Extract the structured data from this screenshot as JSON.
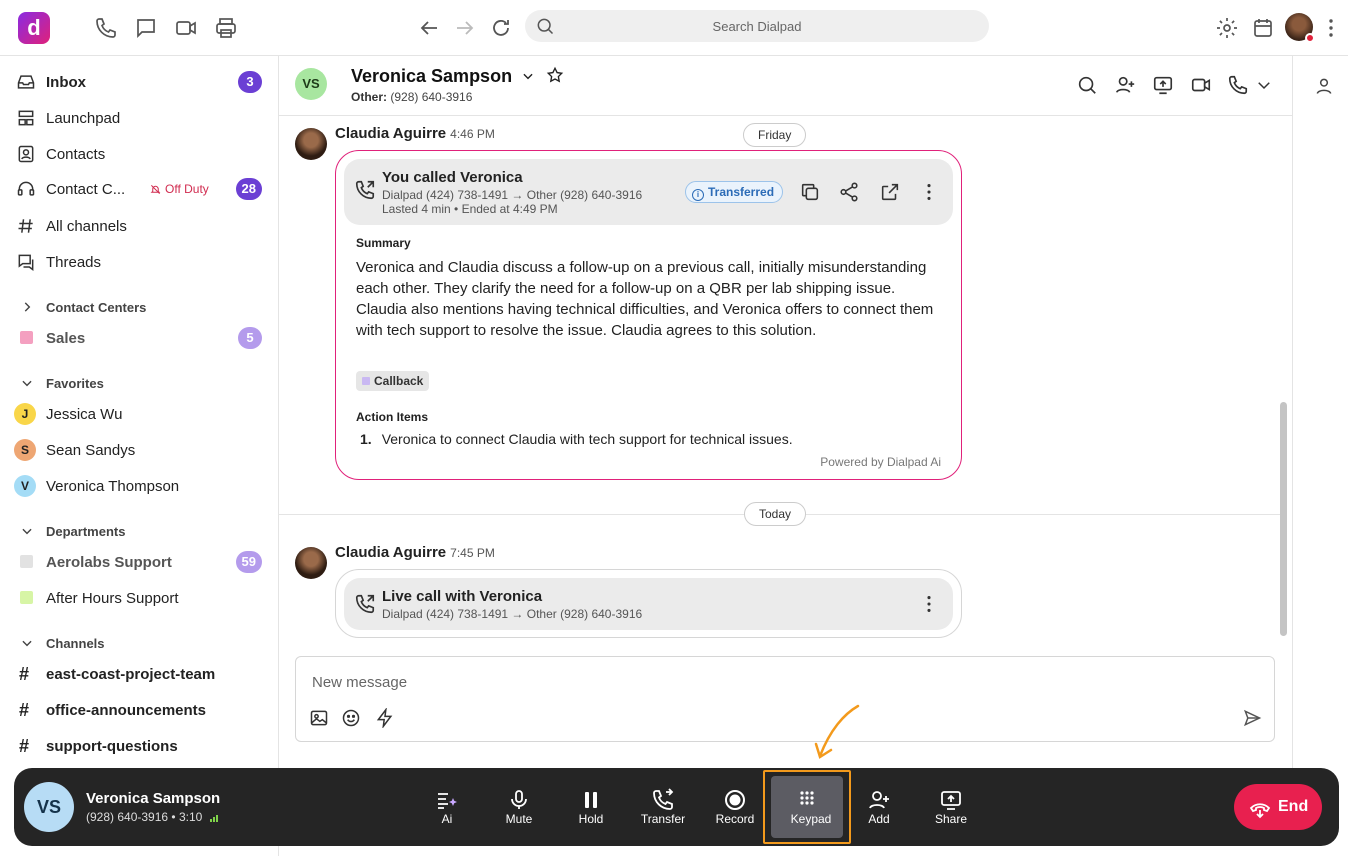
{
  "app": {
    "logo_letter": "d",
    "search_placeholder": "Search Dialpad"
  },
  "sidebar": {
    "items": [
      {
        "label": "Inbox",
        "badge": "3",
        "icon": "inbox-icon"
      },
      {
        "label": "Launchpad",
        "icon": "launchpad-icon"
      },
      {
        "label": "Contacts",
        "icon": "contacts-icon"
      },
      {
        "label": "Contact C...",
        "status": "Off Duty",
        "badge": "28",
        "icon": "headset-icon"
      },
      {
        "label": "All channels",
        "icon": "hash-icon"
      },
      {
        "label": "Threads",
        "icon": "threads-icon"
      }
    ],
    "contact_centers": {
      "title": "Contact Centers",
      "items": [
        {
          "label": "Sales",
          "badge": "5",
          "color": "#f4a0c0"
        }
      ]
    },
    "favorites": {
      "title": "Favorites",
      "items": [
        {
          "label": "Jessica Wu",
          "initial": "J",
          "color": "#f9d649"
        },
        {
          "label": "Sean Sandys",
          "initial": "S",
          "color": "#eea673"
        },
        {
          "label": "Veronica Thompson",
          "initial": "V",
          "color": "#a4dcf6"
        }
      ]
    },
    "departments": {
      "title": "Departments",
      "items": [
        {
          "label": "Aerolabs Support",
          "badge": "59",
          "color": "#e2e2e2"
        },
        {
          "label": "After Hours Support",
          "color": "#d7f5a6"
        }
      ]
    },
    "channels": {
      "title": "Channels",
      "items": [
        {
          "label": "east-coast-project-team"
        },
        {
          "label": "office-announcements"
        },
        {
          "label": "support-questions"
        }
      ]
    }
  },
  "conversation": {
    "initials": "VS",
    "name": "Veronica Sampson",
    "sub_label": "Other:",
    "sub_number": "(928) 640-3916"
  },
  "feed": {
    "day1": "Friday",
    "msg1": {
      "author": "Claudia Aguirre",
      "time": "4:46 PM",
      "call_title": "You called Veronica",
      "call_route": "Dialpad (424) 738-1491 → Other (928) 640-3916",
      "call_meta": "Lasted 4 min • Ended at 4:49 PM",
      "status": "Transferred",
      "summary_heading": "Summary",
      "summary": "Veronica and Claudia discuss a follow-up on a previous call, initially misunderstanding each other. They clarify the need for a follow-up on a QBR per lab shipping issue. Claudia also mentions having technical difficulties, and Veronica offers to connect them with tech support to resolve the issue. Claudia agrees to this solution.",
      "tag": "Callback",
      "action_heading": "Action Items",
      "action_num": "1.",
      "action_text": "Veronica to connect Claudia with tech support for technical issues.",
      "powered_by": "Powered by Dialpad Ai"
    },
    "day2": "Today",
    "msg2": {
      "author": "Claudia Aguirre",
      "time": "7:45 PM",
      "call_title": "Live call with Veronica",
      "call_route": "Dialpad (424) 738-1491 → Other (928) 640-3916"
    }
  },
  "composer": {
    "placeholder": "New message"
  },
  "callbar": {
    "initials": "VS",
    "name": "Veronica Sampson",
    "number": "(928) 640-3916",
    "duration": "• 3:10",
    "controls": [
      "Ai",
      "Mute",
      "Hold",
      "Transfer",
      "Record",
      "Keypad",
      "Add",
      "Share"
    ],
    "end_label": "End"
  },
  "colors": {
    "accent_purple": "#6b3fd4",
    "ai_border": "#e0217a",
    "end_red": "#e8204f",
    "highlight_orange": "#f39a1c"
  }
}
